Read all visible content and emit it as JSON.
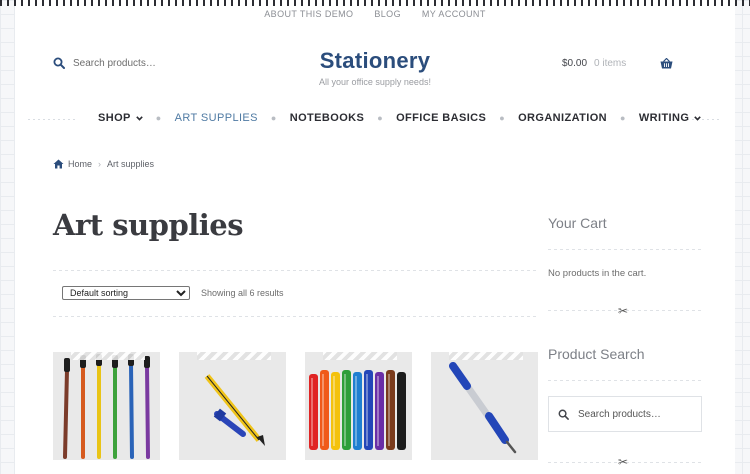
{
  "top_links": [
    "ABOUT THIS DEMO",
    "BLOG",
    "MY ACCOUNT"
  ],
  "header": {
    "search_placeholder": "Search products…",
    "site_title": "Stationery",
    "tagline": "All your office supply needs!",
    "cart_total": "$0.00",
    "cart_items": "0 items"
  },
  "nav": [
    {
      "label": "SHOP",
      "dropdown": true
    },
    {
      "label": "ART SUPPLIES",
      "active": true
    },
    {
      "label": "NOTEBOOKS"
    },
    {
      "label": "OFFICE BASICS"
    },
    {
      "label": "ORGANIZATION"
    },
    {
      "label": "WRITING",
      "dropdown": true
    }
  ],
  "breadcrumb": {
    "home": "Home",
    "current": "Art supplies"
  },
  "page_title": "Art supplies",
  "sorting": {
    "selected": "Default sorting"
  },
  "result_count": "Showing all 6 results",
  "products": [
    {
      "image": "paint-brushes"
    },
    {
      "image": "pencil-and-pen"
    },
    {
      "image": "colored-markers"
    },
    {
      "image": "ballpoint-pen"
    }
  ],
  "sidebar": {
    "cart_title": "Your Cart",
    "cart_empty": "No products in the cart.",
    "search_title": "Product Search",
    "search_placeholder": "Search products…"
  },
  "colors": {
    "brand": "#2b4d7c",
    "active_nav": "#4f7aa3",
    "text": "#43454b"
  }
}
